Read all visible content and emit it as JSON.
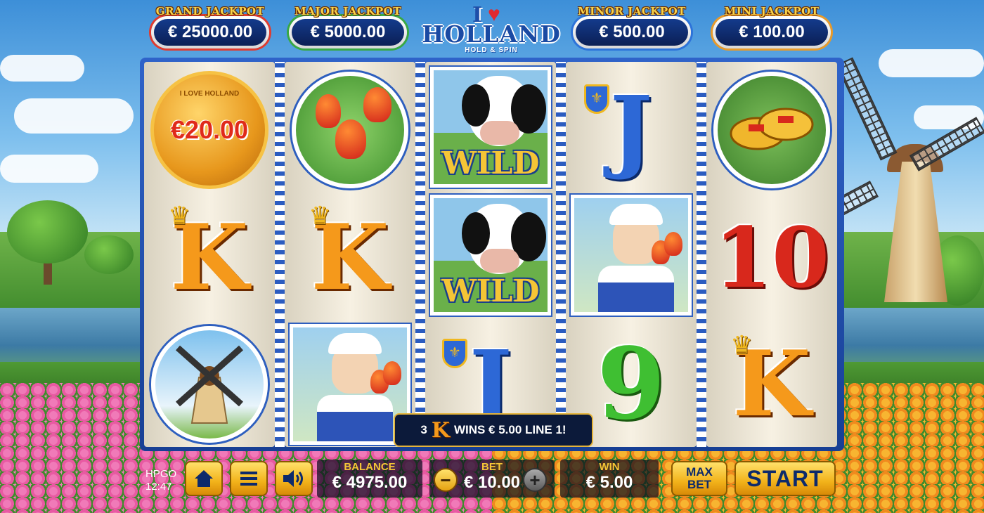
{
  "jackpots": [
    {
      "label": "GRAND JACKPOT",
      "value": "€ 25000.00",
      "color": "#e03b2f"
    },
    {
      "label": "MAJOR JACKPOT",
      "value": "€ 5000.00",
      "color": "#39a843"
    },
    {
      "label": "MINOR JACKPOT",
      "value": "€ 500.00",
      "color": "#2d73d9"
    },
    {
      "label": "MINI JACKPOT",
      "value": "€ 100.00",
      "color": "#e89a2a"
    }
  ],
  "logo": {
    "prefix": "I",
    "main": "HOLLAND",
    "sub": "HOLD & SPIN",
    "heart_icon": "heart-icon"
  },
  "reels": [
    [
      {
        "symbol": "coin",
        "text": "€20.00",
        "coin_caption": "I LOVE HOLLAND"
      },
      {
        "symbol": "K",
        "icon": "crown-icon"
      },
      {
        "symbol": "windmill",
        "icon": "windmill-icon"
      }
    ],
    [
      {
        "symbol": "tulips",
        "icon": "tulip-icon"
      },
      {
        "symbol": "K",
        "icon": "crown-icon"
      },
      {
        "symbol": "dutch-girl",
        "icon": "girl-icon"
      }
    ],
    [
      {
        "symbol": "wild",
        "text": "WILD",
        "icon": "cow-icon"
      },
      {
        "symbol": "wild",
        "text": "WILD",
        "icon": "cow-icon"
      },
      {
        "symbol": "J",
        "icon": "shield-icon"
      }
    ],
    [
      {
        "symbol": "J",
        "icon": "shield-icon"
      },
      {
        "symbol": "dutch-girl",
        "icon": "girl-icon"
      },
      {
        "symbol": "9"
      }
    ],
    [
      {
        "symbol": "clogs",
        "icon": "clogs-icon"
      },
      {
        "symbol": "10"
      },
      {
        "symbol": "K",
        "icon": "crown-icon"
      }
    ]
  ],
  "win_message": {
    "count": "3",
    "symbol": "K",
    "text": "WINS € 5.00 LINE 1!"
  },
  "bottom": {
    "brand": "HPGO",
    "time": "12:47",
    "balance_label": "BALANCE",
    "balance_value": "€ 4975.00",
    "bet_label": "BET",
    "bet_value": "€ 10.00",
    "win_label": "WIN",
    "win_value": "€ 5.00",
    "max_bet_label_1": "MAX",
    "max_bet_label_2": "BET",
    "start_label": "START",
    "home_icon": "home-icon",
    "menu_icon": "menu-icon",
    "sound_icon": "speaker-icon",
    "minus_glyph": "−",
    "plus_glyph": "+"
  }
}
